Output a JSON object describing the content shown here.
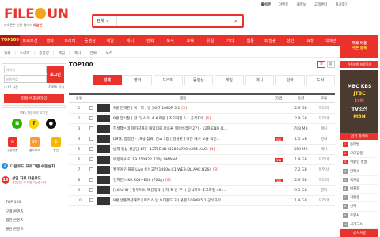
{
  "util": {
    "items": [
      "출석부",
      "이벤트",
      "내정보",
      "고객센터",
      "즐겨찾기"
    ]
  },
  "logo": {
    "brand_a": "FILE",
    "brand_b": "UN",
    "tag_a": "파오픈은 신규 웹하드",
    "tag_b": "파일썬"
  },
  "search": {
    "select_value": "전체"
  },
  "nav": [
    "TOP100",
    "프로모션",
    "영화",
    "드라마",
    "동영상",
    "게임",
    "애니",
    "만화",
    "도서",
    "교육",
    "유틸",
    "기타",
    "웹툰",
    "BJ방송",
    "성인",
    "요청",
    "테마관"
  ],
  "subnav": [
    "영화",
    "드라마",
    "동영상",
    "게임",
    "애니",
    "만화",
    "도서"
  ],
  "login": {
    "id_placeholder": "아이디",
    "pw_placeholder": "비밀번호",
    "button": "로그인",
    "save": "ID 저장",
    "find": "ID/PW 찾기",
    "join": "파일썬 회원가입"
  },
  "sns": {
    "title": "SNS 계정으로 로그인",
    "icons": [
      "N",
      "f",
      "●"
    ]
  },
  "quick": [
    {
      "label": "쿠폰이용",
      "icon": "✉"
    },
    {
      "label": "출석체크",
      "icon": "30"
    },
    {
      "label": "충전",
      "icon": "$"
    }
  ],
  "download": {
    "label": "다운로드 프로그램 수동설치"
  },
  "promo": {
    "num": "19",
    "line1": "성인 자료 다운로드",
    "line2": "성인인증 후 이용 가능합니다."
  },
  "side_menu": [
    "TOP 100",
    "구매 콘텐츠",
    "찜한 콘텐츠",
    "올린 콘텐츠"
  ],
  "content": {
    "title": "TOP100",
    "cats": [
      "전체",
      "영화",
      "드라마",
      "동영상",
      "게임",
      "애니",
      "만화",
      "도서"
    ],
    "headers": {
      "no": "순위",
      "title": "제목",
      "price": "가격",
      "size": "용량",
      "type": "분류"
    },
    "rows": [
      {
        "no": "1",
        "title": "9월 전체판 [ 북 , 격 , 병 ] 6-7 1080P 5.1",
        "cnt": "[3]",
        "price": "",
        "size": "2.9 GB",
        "type": "드라마"
      },
      {
        "no": "2",
        "title": "9월 장식철 [ 한 타 스 틱 4 새로운 ] 초고화질 5.1 공식자막",
        "cnt": "[6]",
        "price": "",
        "size": "2.9 GB",
        "type": "드라마"
      },
      {
        "no": "3",
        "title": "한생했는데 제가창자리 내맘대로 마음을 먹어버리던 27] - 12화 END (1...",
        "cnt": "",
        "price": "",
        "size": "708 MB",
        "type": "애니"
      },
      {
        "no": "4",
        "title": "D9월, 송승헌 · 19금 삼화. 전교 1등 | 검찰판 ] 나는 내가 오늘 죽인...",
        "cnt": "",
        "price": "무료",
        "size": "1.5 GB",
        "type": "영화"
      },
      {
        "no": "5",
        "title": "방해 횡삼 성공담 47] - 12화 END (1280x720 x264 AAC)",
        "cnt": "[4]",
        "price": "",
        "size": "358 MB",
        "type": "애니"
      },
      {
        "no": "6",
        "title": "워킹아우.E119.250922.720p.WANNA",
        "cnt": "",
        "price": "무료",
        "size": "1.9 GB",
        "type": "드라마"
      },
      {
        "no": "7",
        "title": "월웃아구 블로 Live 유신고전.1080p.C1.WEB-DL.AAC.H264",
        "cnt": "[3]",
        "price": "",
        "size": "7.2 GB",
        "type": "동영상"
      },
      {
        "no": "8",
        "title": "컨지언스 KR E01~E06 (720p)",
        "cnt": "[8]",
        "price": "무료",
        "size": "2.9 GB",
        "type": "드라마"
      },
      {
        "no": "9",
        "title": "[4K UHD ] 할두미스 액션대작 (( 저 격 인 무 )) 공식자막 초고화질 4K ...",
        "cnt": "",
        "price": "",
        "size": "9.1 GB",
        "type": "영화"
      },
      {
        "no": "10",
        "title": "9월 생존액션대작 [ 마리스 인 보더랜드 3 ] 본결 1080P 5.1 공식자막",
        "cnt": "",
        "price": "",
        "size": "1.9 GB",
        "type": "드라마"
      }
    ]
  },
  "right": {
    "ad_top_l1": "무료 이용",
    "ad_top_l2": "쿠폰 등록",
    "promo_head": "가족지원 프로모션",
    "tv": [
      "MBC KBS",
      "JTBC",
      "tvN",
      "TV조선",
      "MBN"
    ],
    "rank_head": "인기 검색어",
    "rank": [
      "음마발",
      "크라임랜",
      "위활한 칠일",
      "원피스",
      "국가공",
      "야차봉",
      "최란경",
      "신서",
      "조영서",
      "사기극스"
    ],
    "notice_head": "공지사항"
  },
  "colors": {
    "accent": "#e8322b",
    "accent_dark": "#b3181b"
  }
}
